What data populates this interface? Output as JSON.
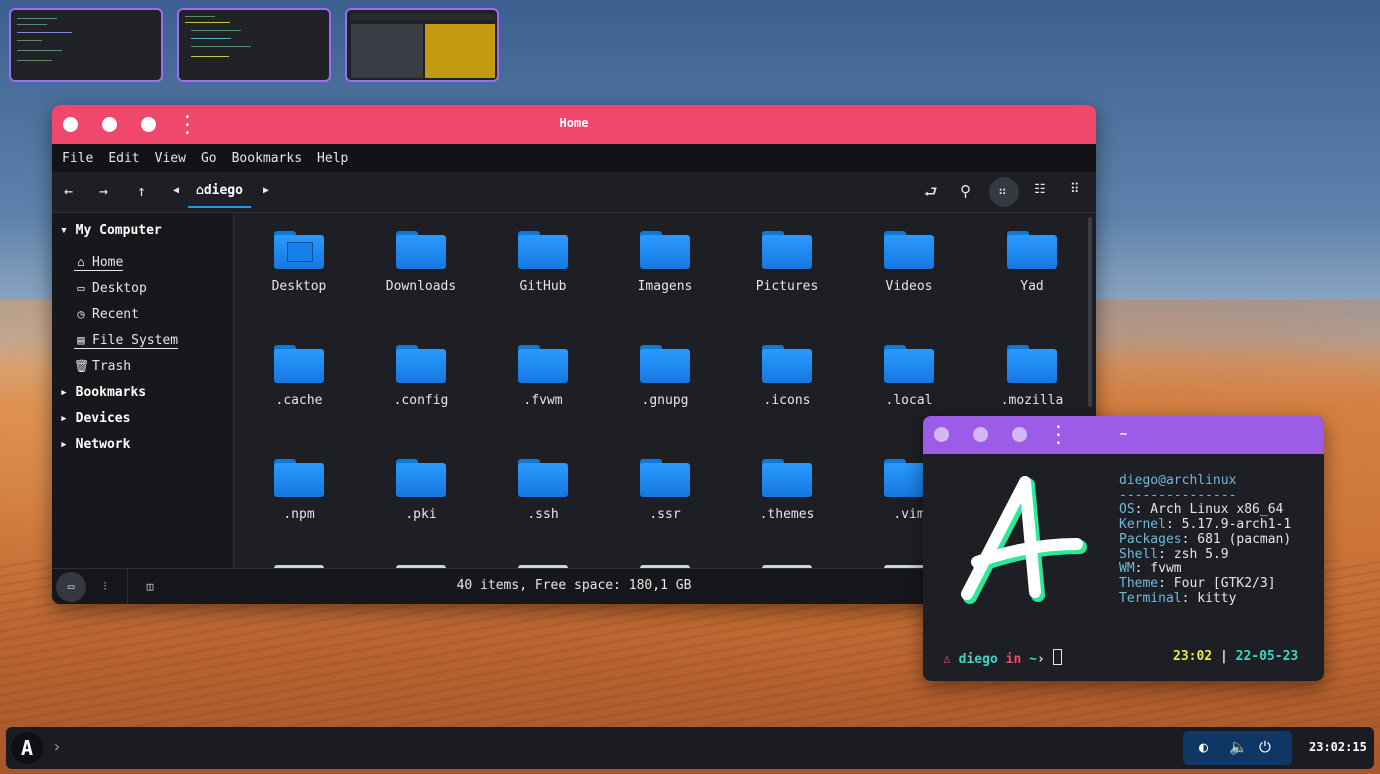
{
  "file_manager": {
    "title": "Home",
    "menu": [
      "File",
      "Edit",
      "View",
      "Go",
      "Bookmarks",
      "Help"
    ],
    "location": "diego",
    "sidebar": {
      "my_computer": "My Computer",
      "items": [
        "Home",
        "Desktop",
        "Recent",
        "File System",
        "Trash"
      ],
      "bookmarks": "Bookmarks",
      "devices": "Devices",
      "network": "Network"
    },
    "folders": [
      "Desktop",
      "Downloads",
      "GitHub",
      "Imagens",
      "Pictures",
      "Videos",
      "Yad",
      ".cache",
      ".config",
      ".fvwm",
      ".gnupg",
      ".icons",
      ".local",
      ".mozilla",
      ".npm",
      ".pki",
      ".ssh",
      ".ssr",
      ".themes",
      ".vim"
    ],
    "status": "40 items, Free space: 180,1 GB"
  },
  "terminal": {
    "title": "~",
    "user_host": "diego@archlinux",
    "separator": "---------------",
    "info": [
      {
        "key": "OS",
        "value": ": Arch Linux x86_64"
      },
      {
        "key": "Kernel",
        "value": ": 5.17.9-arch1-1"
      },
      {
        "key": "Packages",
        "value": ": 681 (pacman)"
      },
      {
        "key": "Shell",
        "value": ": zsh 5.9"
      },
      {
        "key": "WM",
        "value": ": fvwm"
      },
      {
        "key": "Theme",
        "value": ": Four [GTK2/3]"
      },
      {
        "key": "Terminal",
        "value": ": kitty"
      }
    ],
    "prompt_user": "diego",
    "prompt_in": "in",
    "prompt_dir": "~",
    "time": "23:02",
    "date": "22-05-23",
    "colors": {
      "user": "#f0476d",
      "time": "#e6e84a",
      "date": "#3fd6c2",
      "logo_fill": "#ffffff",
      "logo_glow": "#2ee89a"
    }
  },
  "taskbar": {
    "clock": "23:02:15",
    "logo_letter": "A"
  }
}
